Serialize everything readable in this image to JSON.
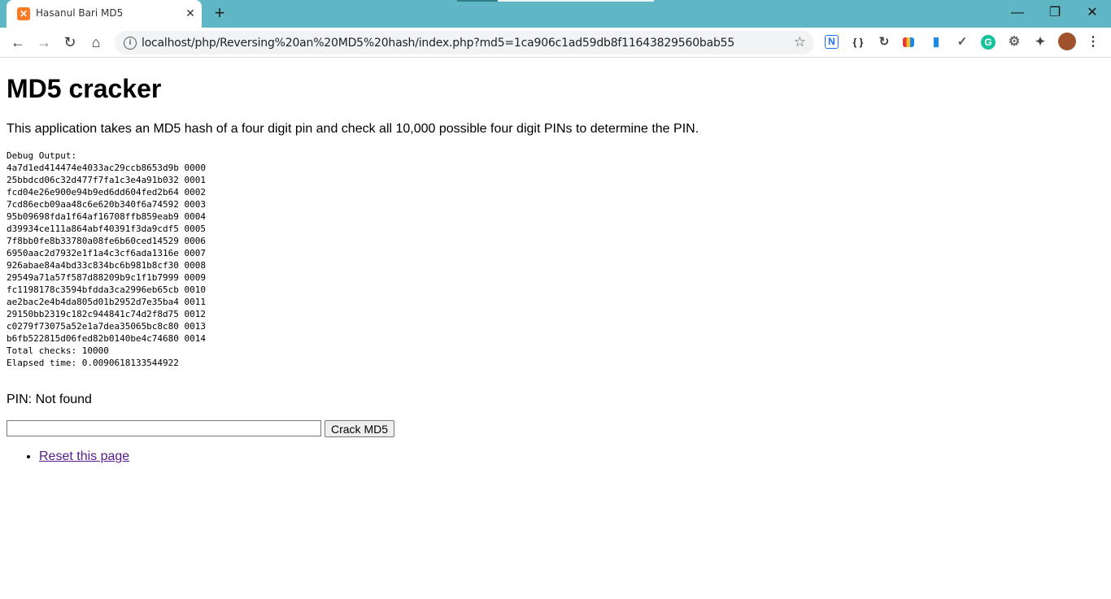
{
  "browser": {
    "tab_title": "Hasanul Bari MD5",
    "url": "localhost/php/Reversing%20an%20MD5%20hash/index.php?md5=1ca906c1ad59db8f11643829560bab55",
    "colors": {
      "tabstrip": "#5fb7c5",
      "favicon": "#fb7a24",
      "link_visited": "#551a8b"
    }
  },
  "page": {
    "title": "MD5 cracker",
    "description": "This application takes an MD5 hash of a four digit pin and check all 10,000 possible four digit PINs to determine the PIN.",
    "debug_header": "Debug Output:",
    "debug_lines": [
      "4a7d1ed414474e4033ac29ccb8653d9b 0000",
      "25bbdcd06c32d477f7fa1c3e4a91b032 0001",
      "fcd04e26e900e94b9ed6dd604fed2b64 0002",
      "7cd86ecb09aa48c6e620b340f6a74592 0003",
      "95b09698fda1f64af16708ffb859eab9 0004",
      "d39934ce111a864abf40391f3da9cdf5 0005",
      "7f8bb0fe8b33780a08fe6b60ced14529 0006",
      "6950aac2d7932e1f1a4c3cf6ada1316e 0007",
      "926abae84a4bd33c834bc6b981b8cf30 0008",
      "29549a71a57f587d88209b9c1f1b7999 0009",
      "fc1198178c3594bfdda3ca2996eb65cb 0010",
      "ae2bac2e4b4da805d01b2952d7e35ba4 0011",
      "29150bb2319c182c944841c74d2f8d75 0012",
      "c0279f73075a52e1a7dea35065bc8c80 0013",
      "b6fb522815d06fed82b0140be4c74680 0014"
    ],
    "total_checks": "Total checks: 10000",
    "elapsed_time": "Elapsed time: 0.0090618133544922",
    "pin_result": "PIN: Not found",
    "input_value": "",
    "button_label": "Crack MD5",
    "reset_link": "Reset this page"
  }
}
